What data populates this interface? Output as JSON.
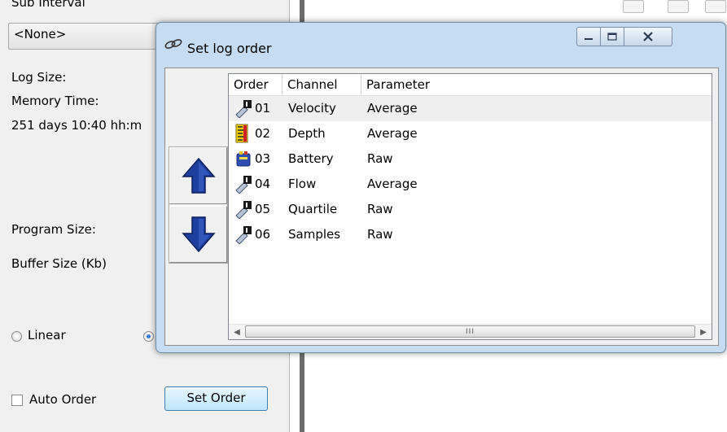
{
  "background_panel": {
    "sub_interval_label": "Sub Interval",
    "combo_value": "<None>",
    "log_size_label": "Log Size:",
    "memory_time_label": "Memory Time:",
    "memory_time_value": "251 days 10:40 hh:m",
    "program_size_label": "Program Size:",
    "buffer_size_label": "Buffer Size (Kb)",
    "linear_label": "Linear",
    "auto_order_label": "Auto Order",
    "set_order_button": "Set Order"
  },
  "dialog": {
    "title": "Set log order",
    "columns": [
      "Order",
      "Channel",
      "Parameter"
    ],
    "rows": [
      {
        "order": "01",
        "channel": "Velocity",
        "parameter": "Average",
        "icon": "sensor-icon",
        "highlighted": true
      },
      {
        "order": "02",
        "channel": "Depth",
        "parameter": "Average",
        "icon": "depth-gauge-icon",
        "highlighted": false
      },
      {
        "order": "03",
        "channel": "Battery",
        "parameter": "Raw",
        "icon": "battery-icon",
        "highlighted": false
      },
      {
        "order": "04",
        "channel": "Flow",
        "parameter": "Average",
        "icon": "sensor-icon",
        "highlighted": false
      },
      {
        "order": "05",
        "channel": "Quartile",
        "parameter": "Raw",
        "icon": "sensor-icon",
        "highlighted": false
      },
      {
        "order": "06",
        "channel": "Samples",
        "parameter": "Raw",
        "icon": "sensor-icon",
        "highlighted": false
      }
    ],
    "scroll_thumb_glyph": "III"
  },
  "colors": {
    "arrow_blue": "#1e3f9e",
    "dialog_frame": "#c6dcf1",
    "row_highlight": "#efefef"
  }
}
